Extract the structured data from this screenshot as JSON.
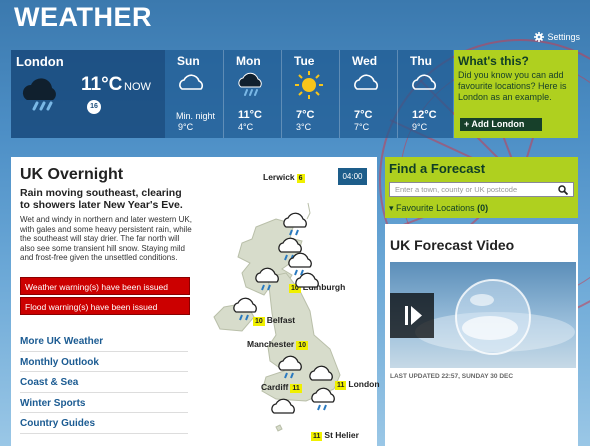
{
  "header": {
    "title": "WEATHER",
    "settings_label": "Settings"
  },
  "current": {
    "location": "London",
    "temp": "11°C",
    "now_label": "NOW",
    "wind": "16"
  },
  "days": [
    {
      "name": "Sun",
      "icon": "cloud-icon",
      "min_label": "Min. night",
      "min": "9°C",
      "max": ""
    },
    {
      "name": "Mon",
      "icon": "rain-cloud-icon",
      "max": "11°C",
      "min": "4°C"
    },
    {
      "name": "Tue",
      "icon": "sun-icon",
      "max": "7°C",
      "min": "3°C"
    },
    {
      "name": "Wed",
      "icon": "cloud-icon",
      "max": "7°C",
      "min": "7°C"
    },
    {
      "name": "Thu",
      "icon": "cloud-icon",
      "max": "12°C",
      "min": "9°C"
    }
  ],
  "whats_this": {
    "title": "What's this?",
    "text": "Did you know you can add favourite locations? Here is London as an example.",
    "button": "+ Add London"
  },
  "overnight": {
    "title": "UK Overnight",
    "subtitle": "Rain moving southeast, clearing to showers later New Year's Eve.",
    "text": "Wet and windy in northern and later western UK, with gales and some heavy persistent rain, while the southeast will stay drier. The far north will also see some transient hill snow. Staying mild and frost-free given the unsettled conditions.",
    "warnings": [
      "Weather warning(s) have been issued",
      "Flood warning(s) have been issued"
    ],
    "links": [
      "More UK Weather",
      "Monthly Outlook",
      "Coast & Sea",
      "Winter Sports",
      "Country Guides"
    ],
    "time": "04:00",
    "cities": [
      {
        "name": "Lerwick",
        "temp": "6"
      },
      {
        "name": "Edinburgh",
        "temp": "10"
      },
      {
        "name": "Belfast",
        "temp": "10"
      },
      {
        "name": "Manchester",
        "temp": "10"
      },
      {
        "name": "Cardiff",
        "temp": "11"
      },
      {
        "name": "London",
        "temp": "11"
      },
      {
        "name": "St Helier",
        "temp": "11"
      }
    ]
  },
  "find": {
    "title": "Find a Forecast",
    "placeholder": "Enter a town, county or UK postcode",
    "favourites_label": "Favourite Locations",
    "favourites_count": "(0)"
  },
  "video": {
    "title": "UK Forecast Video",
    "date": "LAST UPDATED 22:57, SUNDAY 30 DEC"
  }
}
